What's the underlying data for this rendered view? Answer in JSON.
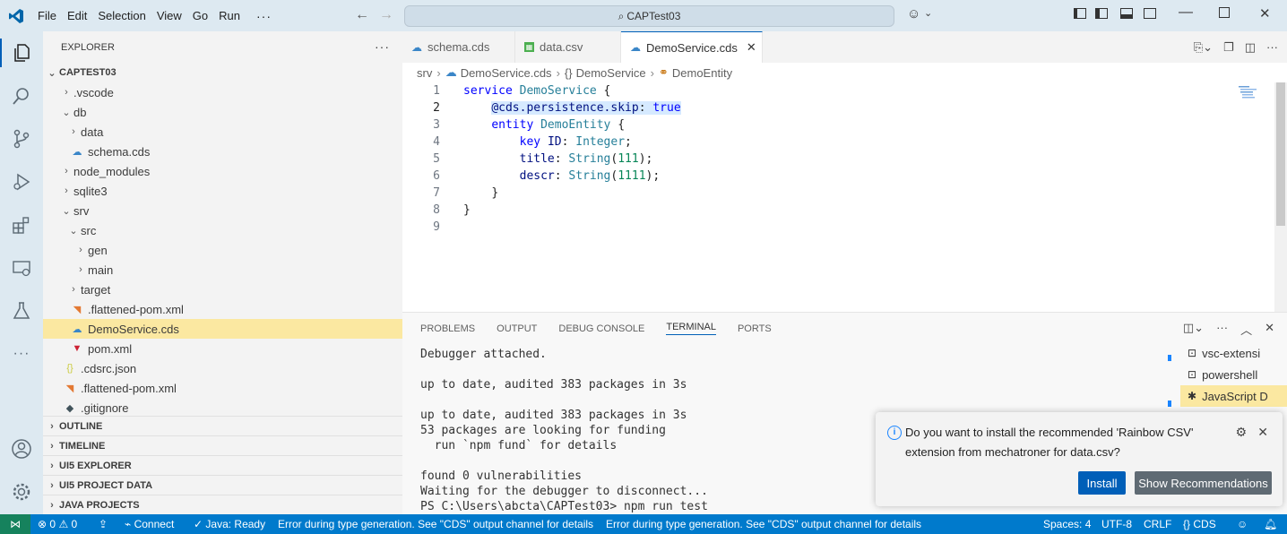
{
  "menu": [
    "File",
    "Edit",
    "Selection",
    "View",
    "Go",
    "Run"
  ],
  "menu_more": "···",
  "command_center": "CAPTest03",
  "sidebar": {
    "title": "EXPLORER",
    "more": "···",
    "root": "CAPTEST03",
    "tree": [
      {
        "label": ".vscode",
        "chevron": "›",
        "icon": ""
      },
      {
        "label": "db",
        "chevron": "⌄",
        "icon": ""
      },
      {
        "label": "data",
        "chevron": "›",
        "icon": ""
      },
      {
        "label": "schema.cds",
        "chevron": "",
        "icon": "cds"
      },
      {
        "label": "node_modules",
        "chevron": "›",
        "icon": ""
      },
      {
        "label": "sqlite3",
        "chevron": "›",
        "icon": ""
      },
      {
        "label": "srv",
        "chevron": "⌄",
        "icon": ""
      },
      {
        "label": "src",
        "chevron": "⌄",
        "icon": ""
      },
      {
        "label": "gen",
        "chevron": "›",
        "icon": ""
      },
      {
        "label": "main",
        "chevron": "›",
        "icon": ""
      },
      {
        "label": "target",
        "chevron": "›",
        "icon": ""
      },
      {
        "label": ".flattened-pom.xml",
        "chevron": "",
        "icon": "rss"
      },
      {
        "label": "DemoService.cds",
        "chevron": "",
        "icon": "cds"
      },
      {
        "label": "pom.xml",
        "chevron": "",
        "icon": "maven"
      },
      {
        "label": ".cdsrc.json",
        "chevron": "",
        "icon": "json"
      },
      {
        "label": ".flattened-pom.xml",
        "chevron": "",
        "icon": "rss"
      },
      {
        "label": ".gitignore",
        "chevron": "",
        "icon": "git"
      }
    ],
    "sections": [
      "OUTLINE",
      "TIMELINE",
      "UI5 EXPLORER",
      "UI5 PROJECT DATA",
      "JAVA PROJECTS"
    ]
  },
  "tabs": [
    {
      "label": "schema.cds"
    },
    {
      "label": "data.csv"
    },
    {
      "label": "DemoService.cds",
      "close": "✕"
    }
  ],
  "breadcrumb": {
    "parts": [
      "srv",
      "DemoService.cds",
      "DemoService",
      "DemoEntity"
    ],
    "sep": "›"
  },
  "code": {
    "line_numbers": [
      "1",
      "2",
      "3",
      "4",
      "5",
      "6",
      "7",
      "8",
      "9"
    ]
  },
  "panel": {
    "tabs": [
      "PROBLEMS",
      "OUTPUT",
      "DEBUG CONSOLE",
      "TERMINAL",
      "PORTS"
    ],
    "active_tab": "TERMINAL",
    "terminal_lines": [
      "Debugger attached.",
      "",
      "up to date, audited 383 packages in 3s",
      "",
      "up to date, audited 383 packages in 3s",
      "53 packages are looking for funding",
      "  run `npm fund` for details",
      "",
      "found 0 vulnerabilities",
      "Waiting for the debugger to disconnect...",
      "PS C:\\Users\\abcta\\CAPTest03> npm run test"
    ],
    "terminal_list": [
      {
        "label": "vsc-extensi",
        "icon": "terminal"
      },
      {
        "label": "powershell",
        "icon": "terminal"
      },
      {
        "label": "JavaScript D",
        "icon": "bug"
      }
    ]
  },
  "notification": {
    "message": "Do you want to install the recommended 'Rainbow CSV' extension from mechatroner for data.csv?",
    "install": "Install",
    "show_recommendations": "Show Recommendations"
  },
  "status": {
    "problems": "0",
    "warnings": "0",
    "connect": "Connect",
    "java": "Java: Ready",
    "error1": "Error during type generation. See \"CDS\" output channel for details",
    "error2": "Error during type generation. See \"CDS\" output channel for details",
    "spaces": "Spaces: 4",
    "encoding": "UTF-8",
    "eol": "CRLF",
    "language": "CDS"
  },
  "colors": {
    "accent": "#005fb8",
    "statusbar": "#007acc",
    "selection": "#fbe8a1",
    "titlebar": "#dde9f1"
  }
}
